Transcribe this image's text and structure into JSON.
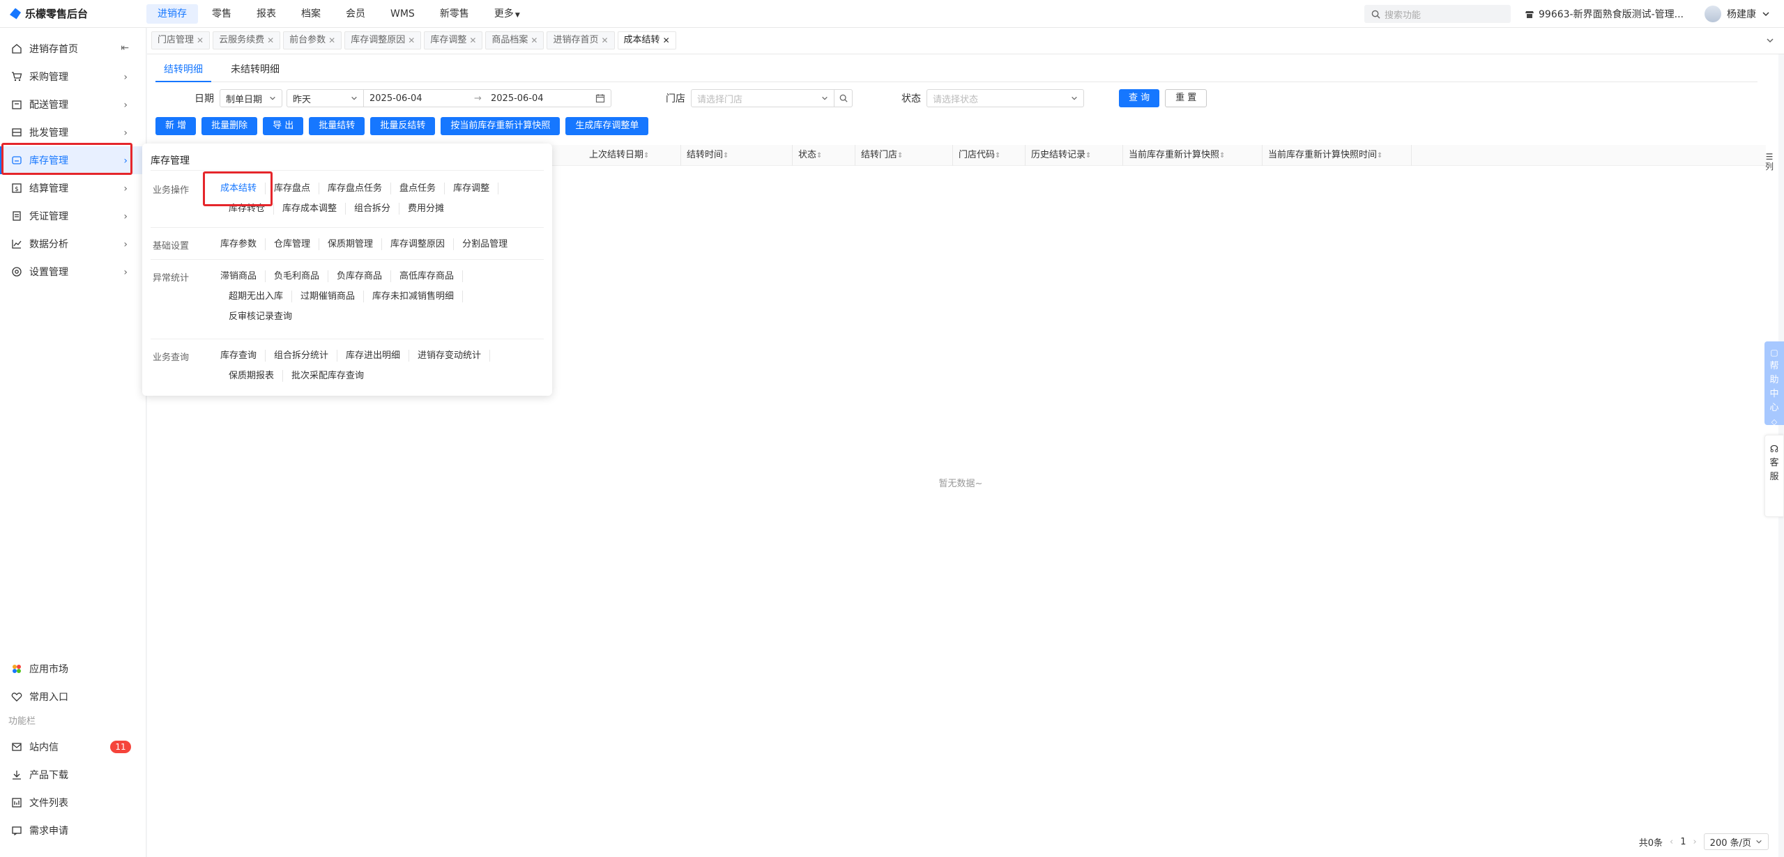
{
  "app": {
    "title": "乐檬零售后台"
  },
  "topnav": {
    "items": [
      "进销存",
      "零售",
      "报表",
      "档案",
      "会员",
      "WMS",
      "新零售",
      "更多"
    ],
    "active_index": 0
  },
  "topbar": {
    "search_placeholder": "搜索功能",
    "store": "99663-新界面熟食版测试-管理...",
    "user": "杨建康"
  },
  "sidebar": {
    "items": [
      {
        "label": "进销存首页",
        "icon": "home-icon"
      },
      {
        "label": "采购管理",
        "icon": "cart-icon"
      },
      {
        "label": "配送管理",
        "icon": "truck-icon"
      },
      {
        "label": "批发管理",
        "icon": "wholesale-icon"
      },
      {
        "label": "库存管理",
        "icon": "inventory-icon"
      },
      {
        "label": "结算管理",
        "icon": "settlement-icon"
      },
      {
        "label": "凭证管理",
        "icon": "voucher-icon"
      },
      {
        "label": "数据分析",
        "icon": "chart-icon"
      },
      {
        "label": "设置管理",
        "icon": "settings-icon"
      }
    ],
    "active_index": 4,
    "bottom": {
      "app_market": "应用市场",
      "common_entry": "常用入口",
      "section_label": "功能栏",
      "messages": "站内信",
      "messages_count": "11",
      "downloads": "产品下载",
      "files": "文件列表",
      "requests": "需求申请"
    }
  },
  "page_tabs": [
    {
      "label": "门店管理"
    },
    {
      "label": "云服务续费"
    },
    {
      "label": "前台参数"
    },
    {
      "label": "库存调整原因"
    },
    {
      "label": "库存调整"
    },
    {
      "label": "商品档案"
    },
    {
      "label": "进销存首页"
    },
    {
      "label": "成本结转",
      "active": true
    }
  ],
  "subtabs": {
    "items": [
      "结转明细",
      "未结转明细"
    ],
    "active_index": 0
  },
  "filters": {
    "date_label": "日期",
    "date_type": "制单日期",
    "date_range_preset": "昨天",
    "date_start": "2025-06-04",
    "date_end": "2025-06-04",
    "date_separator": "→",
    "store_label": "门店",
    "store_placeholder": "请选择门店",
    "status_label": "状态",
    "status_placeholder": "请选择状态",
    "query": "查 询",
    "reset": "重 置"
  },
  "actions": [
    "新 增",
    "批量删除",
    "导 出",
    "批量结转",
    "批量反结转",
    "按当前库存重新计算快照",
    "生成库存调整单"
  ],
  "table": {
    "columns": [
      "上次结转日期",
      "结转时间",
      "状态",
      "结转门店",
      "门店代码",
      "历史结转记录",
      "当前库存重新计算快照",
      "当前库存重新计算快照时间"
    ],
    "empty_text": "暂无数据~",
    "column_setting": "列"
  },
  "pagination": {
    "total": "共0条",
    "page": "1",
    "page_size": "200 条/页"
  },
  "float": {
    "help": [
      "帮",
      "助",
      "中",
      "心"
    ],
    "service": [
      "客",
      "服"
    ]
  },
  "popover": {
    "title": "库存管理",
    "groups": [
      {
        "name": "业务操作",
        "links": [
          "成本结转",
          "库存盘点",
          "库存盘点任务",
          "盘点任务",
          "库存调整",
          "库存转仓",
          "库存成本调整",
          "组合拆分",
          "费用分摊"
        ],
        "active_link": 0
      },
      {
        "name": "基础设置",
        "links": [
          "库存参数",
          "仓库管理",
          "保质期管理",
          "库存调整原因",
          "分割品管理"
        ]
      },
      {
        "name": "异常统计",
        "links": [
          "滞销商品",
          "负毛利商品",
          "负库存商品",
          "高低库存商品",
          "超期无出入库",
          "过期催销商品",
          "库存未扣减销售明细",
          "反审核记录查询"
        ]
      },
      {
        "name": "业务查询",
        "links": [
          "库存查询",
          "组合拆分统计",
          "库存进出明细",
          "进销存变动统计",
          "保质期报表",
          "批次采配库存查询"
        ]
      }
    ]
  },
  "colors": {
    "primary": "#1677ff",
    "highlight": "#e5262b",
    "badge": "#f5443b"
  }
}
